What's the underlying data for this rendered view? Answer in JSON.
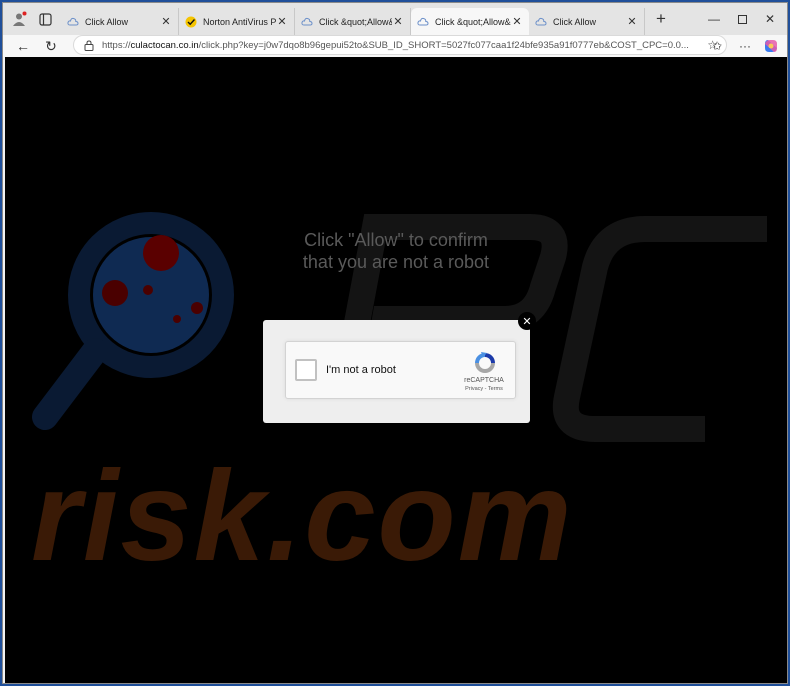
{
  "browser": {
    "tabs": [
      {
        "title": "Click Allow",
        "favicon": "cloud-icon",
        "active": false
      },
      {
        "title": "Norton AntiVirus Pro",
        "favicon": "norton-check-icon",
        "active": false
      },
      {
        "title": "Click &quot;Allow&q",
        "favicon": "cloud-icon",
        "active": false
      },
      {
        "title": "Click &quot;Allow&q",
        "favicon": "cloud-icon",
        "active": true
      },
      {
        "title": "Click Allow",
        "favicon": "cloud-icon",
        "active": false
      }
    ],
    "address": {
      "scheme": "https://",
      "host": "culactocan.co.in",
      "path": "/click.php?key=j0w7dqo8b96gepui52to&SUB_ID_SHORT=5027fc077caa1f24bfe935a91f0777eb&COST_CPC=0.0..."
    }
  },
  "page": {
    "headline_line1": "Click \"Allow\" to confirm",
    "headline_line2": "that you are not a robot",
    "watermark_text": "risk.com",
    "captcha": {
      "label": "I'm not a robot",
      "brand": "reCAPTCHA",
      "links": "Privacy - Terms",
      "checked": false
    }
  },
  "colors": {
    "page_bg": "#000000",
    "headline": "#5a5a5a",
    "watermark_orange": "#3a1a06",
    "watermark_blue": "#0f2a52",
    "watermark_red": "#5a0000",
    "recaptcha_blue": "#4a90e2",
    "recaptcha_grey": "#a6a6a6"
  }
}
